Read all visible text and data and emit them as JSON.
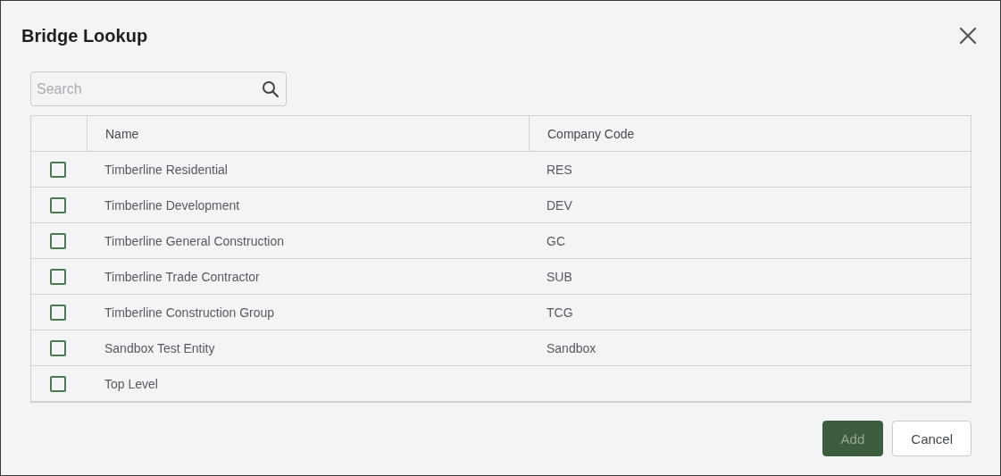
{
  "dialog": {
    "title": "Bridge Lookup"
  },
  "search": {
    "placeholder": "Search"
  },
  "table": {
    "columns": [
      "Name",
      "Company Code"
    ],
    "rows": [
      {
        "checked": false,
        "name": "Timberline Residential",
        "code": "RES"
      },
      {
        "checked": false,
        "name": "Timberline Development",
        "code": "DEV"
      },
      {
        "checked": false,
        "name": "Timberline General Construction",
        "code": "GC"
      },
      {
        "checked": false,
        "name": "Timberline Trade Contractor",
        "code": "SUB"
      },
      {
        "checked": false,
        "name": "Timberline Construction Group",
        "code": "TCG"
      },
      {
        "checked": false,
        "name": "Sandbox Test Entity",
        "code": "Sandbox"
      },
      {
        "checked": false,
        "name": "Top Level"
      }
    ]
  },
  "buttons": [
    {
      "kind": "primary",
      "label": "Add",
      "disabled": true
    },
    {
      "kind": "secondary",
      "label": "Cancel",
      "disabled": false
    }
  ]
}
